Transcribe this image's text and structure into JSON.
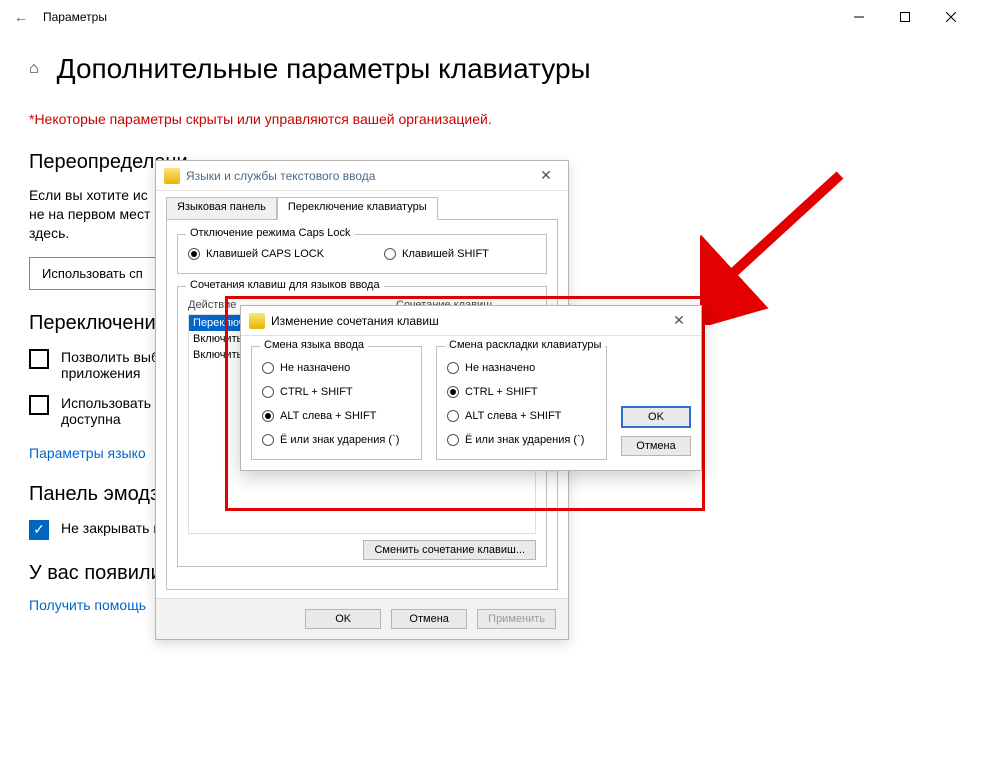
{
  "window": {
    "title": "Параметры",
    "page_title": "Дополнительные параметры клавиатуры",
    "admin_warning": "*Некоторые параметры скрыты или управляются вашей организацией."
  },
  "s1": {
    "header": "Переопределени",
    "body": "Если вы хотите ис\nне на первом мест\nздесь.",
    "dropdown": "Использовать сп"
  },
  "s2": {
    "header": "Переключение",
    "cb1": "Позволить выб\nприложения",
    "cb2": "Использовать\nдоступна",
    "link": "Параметры языко"
  },
  "s3": {
    "header": "Панель эмодзи",
    "cb": "Не закрывать панель автоматически после ввода эмодзи"
  },
  "s4": {
    "header": "У вас появились вопросы?",
    "link": "Получить помощь"
  },
  "dlg1": {
    "title": "Языки и службы текстового ввода",
    "tabs": {
      "t1": "Языковая панель",
      "t2": "Переключение клавиатуры"
    },
    "caps_legend": "Отключение режима Caps Lock",
    "caps_opt1": "Клавишей CAPS LOCK",
    "caps_opt2": "Клавишей SHIFT",
    "combo_legend": "Сочетания клавиш для языков ввода",
    "col_action": "Действие",
    "col_keys": "Сочетание клавиш",
    "rows": [
      "Переключ",
      "Включить",
      "Включить"
    ],
    "change_btn": "Сменить сочетание клавиш...",
    "ok": "OK",
    "cancel": "Отмена",
    "apply": "Применить"
  },
  "dlg2": {
    "title": "Изменение сочетания клавиш",
    "left_legend": "Смена языка ввода",
    "right_legend": "Смена раскладки клавиатуры",
    "opts": {
      "none": "Не назначено",
      "ctrl": "CTRL + SHIFT",
      "alt": "ALT слева + SHIFT",
      "yo": "Ё или знак ударения (`)"
    },
    "ok": "OK",
    "cancel": "Отмена"
  }
}
